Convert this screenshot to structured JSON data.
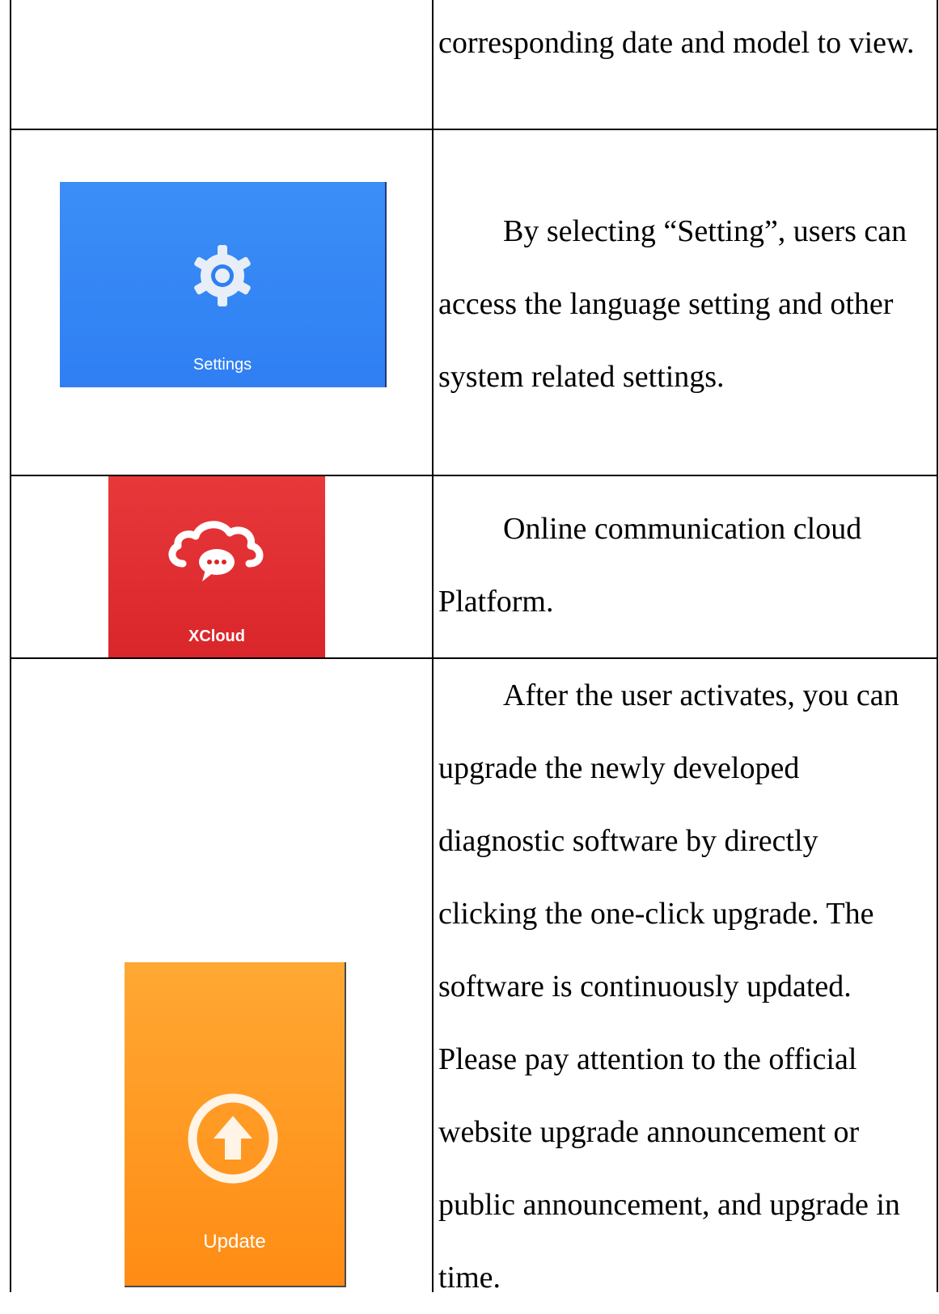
{
  "rows": [
    {
      "text": [
        "corresponding date and model to view."
      ]
    },
    {
      "tile": {
        "label": "Settings",
        "color": "#2f7ff3",
        "icon": "gear-icon"
      },
      "text": [
        "By selecting “Setting”, users can",
        "access the language setting and other",
        "system related settings."
      ]
    },
    {
      "tile": {
        "label": "XCloud",
        "color": "#d9262b",
        "icon": "cloud-chat-icon"
      },
      "text": [
        "Online communication cloud",
        "Platform."
      ]
    },
    {
      "tile": {
        "label": "Update",
        "color": "#ff8c14",
        "icon": "upload-arrow-icon"
      },
      "text": [
        "After the user activates, you can",
        "upgrade the newly developed",
        "diagnostic software by directly",
        "clicking the one-click upgrade. The",
        "software is continuously updated.",
        "Please pay attention to the official",
        "website upgrade announcement or",
        "public announcement, and upgrade in",
        "time."
      ]
    }
  ]
}
